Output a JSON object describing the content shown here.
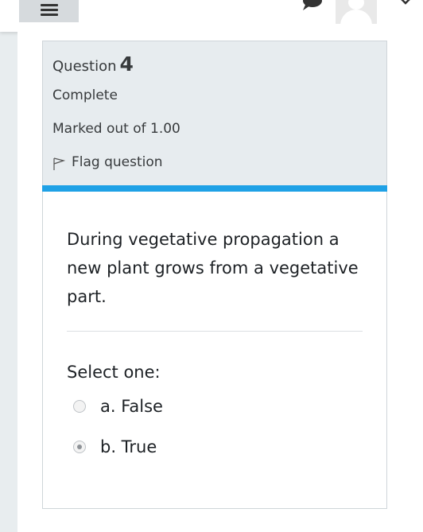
{
  "header": {
    "menu_icon": "hamburger-menu-icon",
    "messages_icon": "chat-bubble-icon",
    "avatar_icon": "user-avatar-icon",
    "dropdown_icon": "chevron-down-icon"
  },
  "question": {
    "label": "Question",
    "number": "4",
    "state": "Complete",
    "grade": "Marked out of 1.00",
    "flag_label": "Flag question",
    "flag_icon": "flag-outline-icon",
    "text": "During vegetative propagation a new plant grows from a vegetative part.",
    "prompt": "Select one:",
    "options": [
      {
        "label": "a. False",
        "selected": false
      },
      {
        "label": "b. True",
        "selected": true
      }
    ]
  },
  "colors": {
    "accent_bar": "#1fa1e6",
    "info_background": "#e7ecef",
    "page_background": "#e8edef"
  }
}
